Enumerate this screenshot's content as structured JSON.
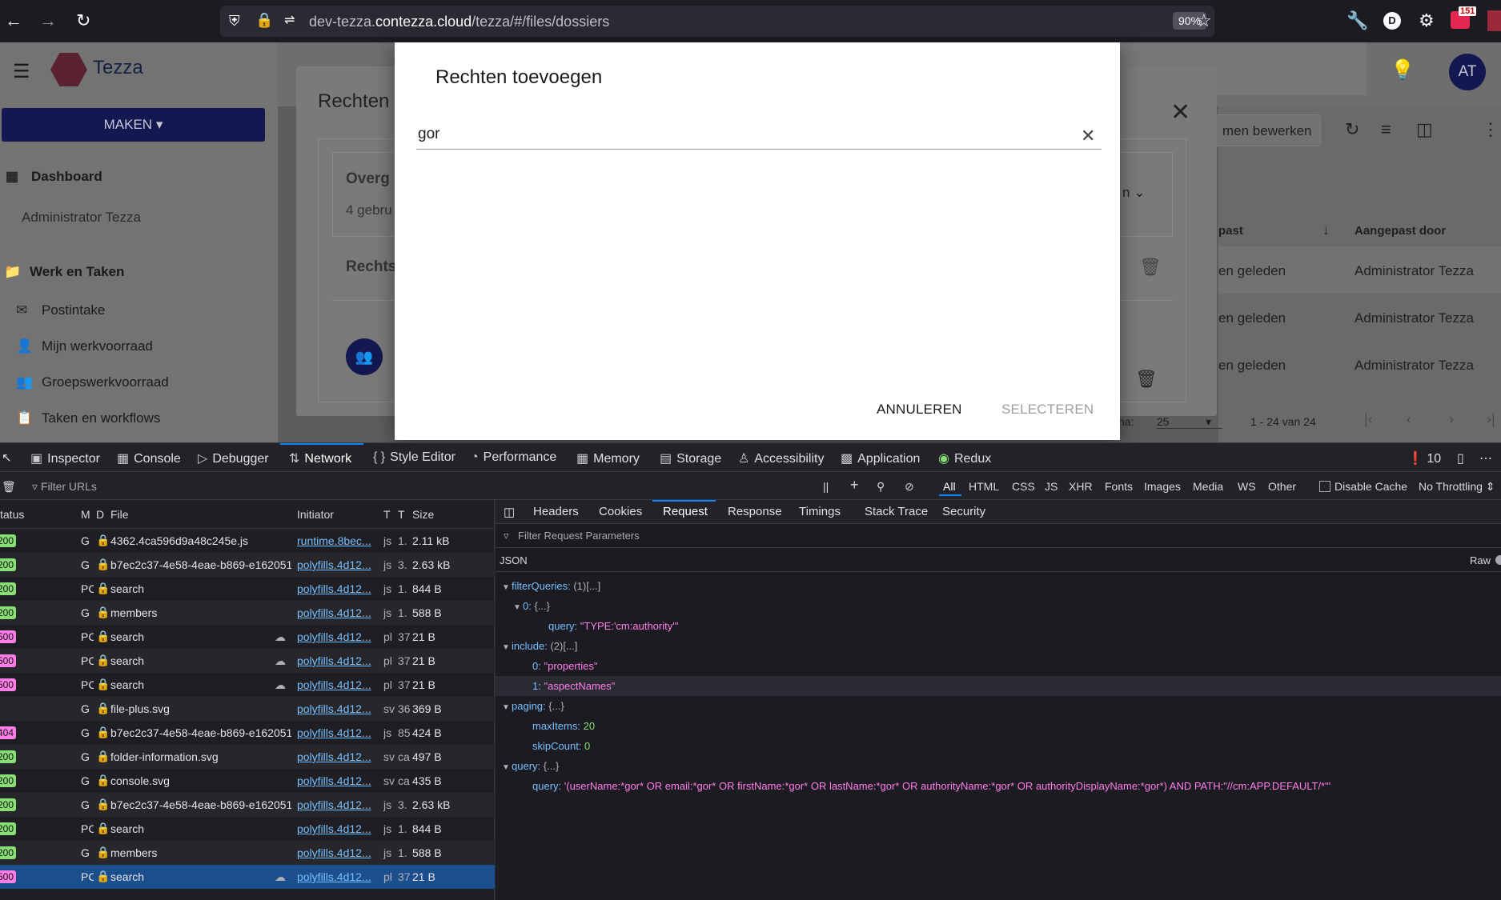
{
  "browser": {
    "url_prefix": "dev-tezza.",
    "url_domain": "contezza.cloud",
    "url_path": "/tezza/#/files/dossiers",
    "zoom": "90%",
    "notif_count": "151",
    "profile_letter": "D"
  },
  "app": {
    "logo": "Tezza",
    "create_button": "MAKEN",
    "avatar": "AT",
    "sidebar": {
      "dashboard": "Dashboard",
      "user": "Administrator Tezza",
      "work_section": "Werk en Taken",
      "items": [
        "Postintake",
        "Mijn werkvoorraad",
        "Groepswerkvoorraad",
        "Taken en workflows"
      ]
    },
    "toolbar_edit": "men bewerken",
    "table": {
      "col_modified": "past",
      "col_modified_by": "Aangepast door",
      "rows": [
        {
          "when": "en geleden",
          "by": "Administrator Tezza"
        },
        {
          "when": "en geleden",
          "by": "Administrator Tezza"
        },
        {
          "when": "en geleden",
          "by": "Administrator Tezza"
        }
      ],
      "page_label": "na:",
      "page_size": "25",
      "range": "1 - 24 van 24"
    },
    "rights_panel": {
      "title": "Rechten",
      "overview": "Overg",
      "users": "4 gebru",
      "rights": "Rechts",
      "dropdown_tail": "n"
    }
  },
  "modal": {
    "title": "Rechten toevoegen",
    "search_value": "gor",
    "cancel": "ANNULEREN",
    "select": "SELECTEREN"
  },
  "devtools": {
    "tabs": [
      "Inspector",
      "Console",
      "Debugger",
      "Network",
      "Style Editor",
      "Performance",
      "Memory",
      "Storage",
      "Accessibility",
      "Application",
      "Redux"
    ],
    "error_count": "10",
    "filter_placeholder": "Filter URLs",
    "type_filters": [
      "All",
      "HTML",
      "CSS",
      "JS",
      "XHR",
      "Fonts",
      "Images",
      "Media",
      "WS",
      "Other"
    ],
    "disable_cache": "Disable Cache",
    "throttling": "No Throttling",
    "columns": {
      "status": "tatus",
      "method": "M",
      "domain": "D",
      "file": "File",
      "initiator": "Initiator",
      "type": "T",
      "transferred": "T",
      "size": "Size"
    },
    "requests": [
      {
        "status": "200",
        "method": "G",
        "file": "4362.4ca596d9a48c245e.js",
        "initiator": "runtime.8bec...",
        "type": "js",
        "trans": "1.",
        "size": "2.11 kB"
      },
      {
        "status": "200",
        "method": "G",
        "file": "b7ec2c37-4e58-4eae-b869-e162051e",
        "initiator": "polyfills.4d12...",
        "type": "js",
        "trans": "3.",
        "size": "2.63 kB"
      },
      {
        "status": "200",
        "method": "PC",
        "file": "search",
        "initiator": "polyfills.4d12...",
        "type": "js",
        "trans": "1.",
        "size": "844 B"
      },
      {
        "status": "200",
        "method": "G",
        "file": "members",
        "initiator": "polyfills.4d12...",
        "type": "js",
        "trans": "1.",
        "size": "588 B"
      },
      {
        "status": "500",
        "method": "PC",
        "file": "search",
        "initiator": "polyfills.4d12...",
        "type": "pl",
        "trans": "37",
        "size": "21 B"
      },
      {
        "status": "500",
        "method": "PC",
        "file": "search",
        "initiator": "polyfills.4d12...",
        "type": "pl",
        "trans": "37",
        "size": "21 B"
      },
      {
        "status": "500",
        "method": "PC",
        "file": "search",
        "initiator": "polyfills.4d12...",
        "type": "pl",
        "trans": "37",
        "size": "21 B"
      },
      {
        "status": "",
        "method": "G",
        "file": "file-plus.svg",
        "initiator": "polyfills.4d12...",
        "type": "sv",
        "trans": "36",
        "size": "369 B"
      },
      {
        "status": "404",
        "method": "G",
        "file": "b7ec2c37-4e58-4eae-b869-e162051e",
        "initiator": "polyfills.4d12...",
        "type": "js",
        "trans": "85",
        "size": "424 B"
      },
      {
        "status": "200",
        "method": "G",
        "file": "folder-information.svg",
        "initiator": "polyfills.4d12...",
        "type": "sv",
        "trans": "ca",
        "size": "497 B"
      },
      {
        "status": "200",
        "method": "G",
        "file": "console.svg",
        "initiator": "polyfills.4d12...",
        "type": "sv",
        "trans": "ca",
        "size": "435 B"
      },
      {
        "status": "200",
        "method": "G",
        "file": "b7ec2c37-4e58-4eae-b869-e162051e",
        "initiator": "polyfills.4d12...",
        "type": "js",
        "trans": "3.",
        "size": "2.63 kB"
      },
      {
        "status": "200",
        "method": "PC",
        "file": "search",
        "initiator": "polyfills.4d12...",
        "type": "js",
        "trans": "1.",
        "size": "844 B"
      },
      {
        "status": "200",
        "method": "G",
        "file": "members",
        "initiator": "polyfills.4d12...",
        "type": "js",
        "trans": "1.",
        "size": "588 B"
      },
      {
        "status": "500",
        "method": "PC",
        "file": "search",
        "initiator": "polyfills.4d12...",
        "type": "pl",
        "trans": "37",
        "size": "21 B"
      }
    ],
    "detail_tabs": [
      "Headers",
      "Cookies",
      "Request",
      "Response",
      "Timings",
      "Stack Trace",
      "Security"
    ],
    "filter_params": "Filter Request Parameters",
    "json_label": "JSON",
    "raw_label": "Raw",
    "json": {
      "filterQueries": "filterQueries:",
      "filterQueries_summary": "(1)[...]",
      "fq0": "0:",
      "fq0_summary": "{...}",
      "query_key": "query:",
      "query_val": "\"TYPE:'cm:authority'\"",
      "include": "include:",
      "include_summary": "(2)[...]",
      "inc0_key": "0:",
      "inc0": "\"properties\"",
      "inc1_key": "1:",
      "inc1": "\"aspectNames\"",
      "paging": "paging:",
      "paging_summary": "{...}",
      "maxItems_key": "maxItems:",
      "maxItems": "20",
      "skipCount_key": "skipCount:",
      "skipCount": "0",
      "query": "query:",
      "query_summary": "{...}",
      "query2_key": "query:",
      "query2_val": "'(userName:*gor* OR email:*gor* OR firstName:*gor* OR lastName:*gor* OR authorityName:*gor* OR authorityDisplayName:*gor*) AND PATH:\"//cm:APP.DEFAULT/*\"'"
    }
  }
}
